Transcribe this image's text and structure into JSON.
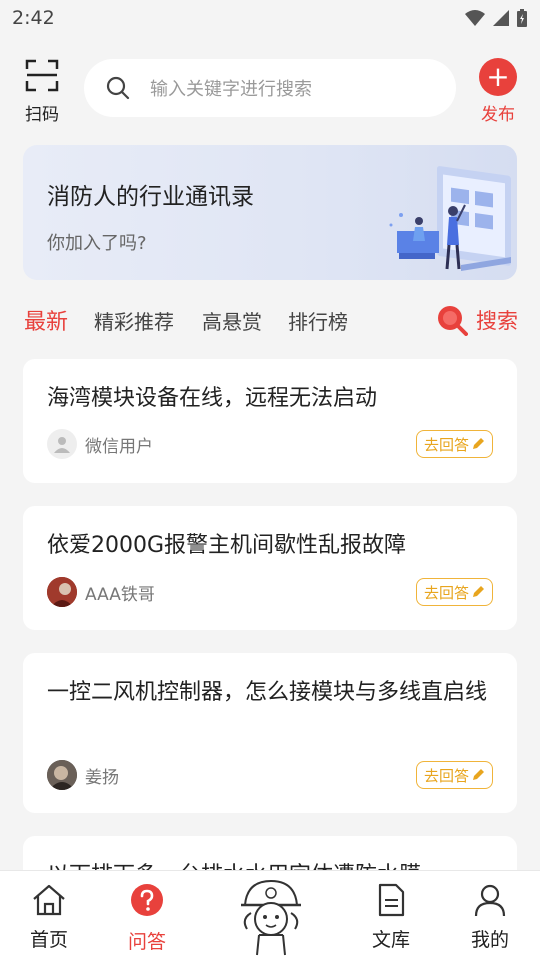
{
  "status_bar": {
    "time": "2:42"
  },
  "header": {
    "scan_label": "扫码",
    "search_placeholder": "输入关键字进行搜索",
    "publish_label": "发布"
  },
  "banner": {
    "title": "消防人的行业通讯录",
    "subtitle": "你加入了吗?"
  },
  "tabs": [
    {
      "label": "最新",
      "active": true
    },
    {
      "label": "精彩推荐",
      "active": false
    },
    {
      "label": "高悬赏",
      "active": false
    },
    {
      "label": "排行榜",
      "active": false
    }
  ],
  "tab_search_label": "搜索",
  "questions": [
    {
      "title": "海湾模块设备在线，远程无法启动",
      "user": "微信用户",
      "action": "去回答"
    },
    {
      "title": "依爱2000G报警主机间歇性乱报故障",
      "user": "AAA铁哥",
      "action": "去回答"
    },
    {
      "title": "一控二风机控制器，怎么接模块与多线直启线",
      "user": "姜扬",
      "action": "去回答"
    },
    {
      "title": "以下排下多一台排水水用字体遭防水膜",
      "user": "",
      "action": ""
    }
  ],
  "bottom_nav": [
    {
      "label": "首页",
      "icon": "home-icon",
      "active": false
    },
    {
      "label": "问答",
      "icon": "question-icon",
      "active": true
    },
    {
      "label": "",
      "icon": "mascot-icon",
      "active": false
    },
    {
      "label": "文库",
      "icon": "document-icon",
      "active": false
    },
    {
      "label": "我的",
      "icon": "profile-icon",
      "active": false
    }
  ],
  "colors": {
    "accent": "#e8413c",
    "answer": "#e8a51e",
    "background": "#f4f4f4"
  }
}
